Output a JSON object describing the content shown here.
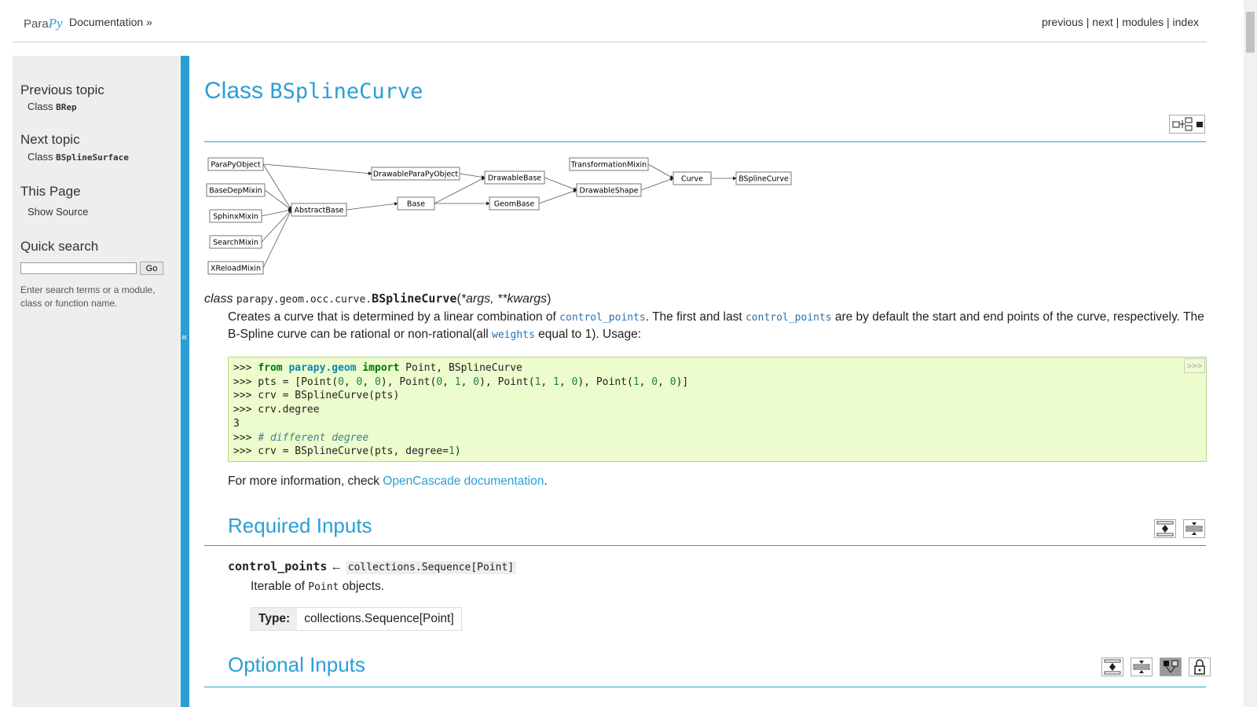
{
  "header": {
    "logo": "ParaPy",
    "logo_a": "Para",
    "logo_b": "Py",
    "breadcrumb": "Documentation »",
    "nav": [
      "previous",
      "next",
      "modules",
      "index"
    ]
  },
  "sidebar": {
    "prev_title": "Previous topic",
    "prev_pre": "Class ",
    "prev_code": "BRep",
    "next_title": "Next topic",
    "next_pre": "Class ",
    "next_code": "BSplineSurface",
    "this_title": "This Page",
    "show_source": "Show Source",
    "search_title": "Quick search",
    "search_value": "",
    "go": "Go",
    "hint": "Enter search terms or a module, class or function name.",
    "collapse": "«"
  },
  "main": {
    "title_pre": "Class ",
    "title_code": "BSplineCurve",
    "diagram": {
      "nodes": [
        "ParaPyObject",
        "BaseDepMixin",
        "SphinxMixin",
        "SearchMixin",
        "XReloadMixin",
        "AbstractBase",
        "DrawableParaPyObject",
        "Base",
        "DrawableBase",
        "GeomBase",
        "TransformationMixin",
        "DrawableShape",
        "Curve",
        "BSplineCurve"
      ]
    },
    "sig": {
      "kw": "class",
      "module": "parapy.geom.occ.curve.",
      "name": "BSplineCurve",
      "args": "*args, **kwargs"
    },
    "desc": {
      "t1": "Creates a curve that is determined by a linear combination of ",
      "c1": "control_points",
      "t2": ". The first and last ",
      "c2": "control_points",
      "t3": " are by default the start and end points of the curve, respectively. The B-Spline curve can be rational or non-rational(all ",
      "c3": "weights",
      "t4": " equal to 1). Usage:"
    },
    "code": {
      "lines": [
        ">>> from parapy.geom import Point, BSplineCurve",
        ">>> pts = [Point(0, 0, 0), Point(0, 1, 0), Point(1, 1, 0), Point(1, 0, 0)]",
        ">>> crv = BSplineCurve(pts)",
        ">>> crv.degree",
        "3",
        ">>> # different degree",
        ">>> crv = BSplineCurve(pts, degree=1)"
      ],
      "copy": ">>>"
    },
    "more_pre": "For more information, check ",
    "more_link": "OpenCascade documentation",
    "more_post": ".",
    "required_title": "Required Inputs",
    "param": {
      "name": "control_points",
      "arrow": " ← ",
      "type": "collections.Sequence[Point]",
      "d1": "Iterable of ",
      "dcode": "Point",
      "d2": " objects.",
      "type_label": "Type:",
      "type_value": "collections.Sequence[Point]"
    },
    "optional_title": "Optional Inputs"
  }
}
